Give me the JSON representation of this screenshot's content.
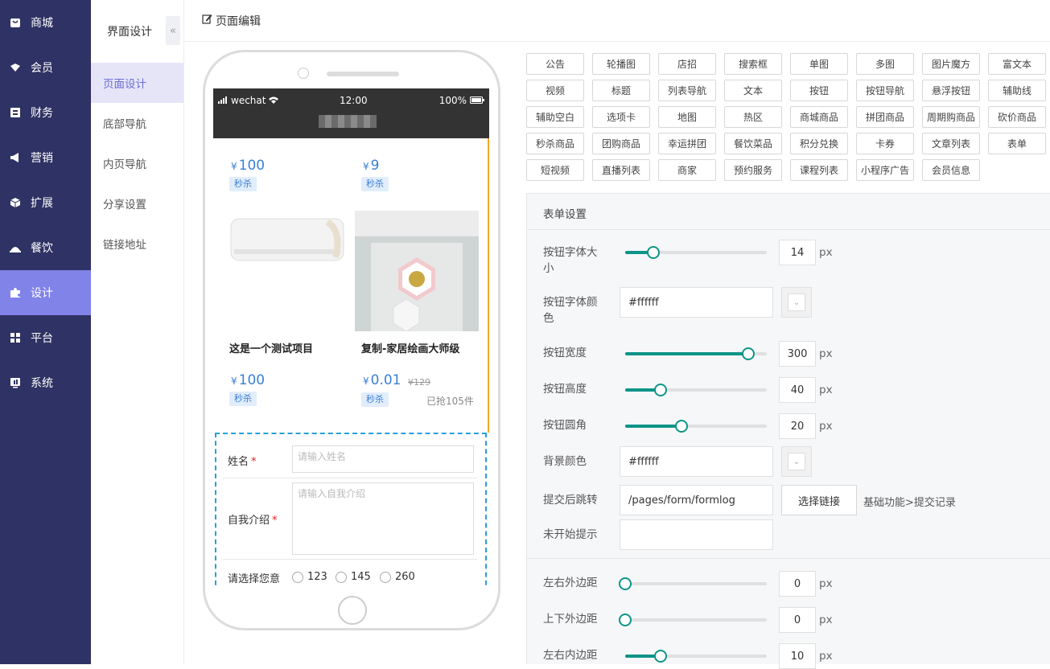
{
  "nav": {
    "items": [
      {
        "label": "商城",
        "icon": "store-icon"
      },
      {
        "label": "会员",
        "icon": "member-icon"
      },
      {
        "label": "财务",
        "icon": "finance-icon"
      },
      {
        "label": "营销",
        "icon": "megaphone-icon"
      },
      {
        "label": "扩展",
        "icon": "cube-icon"
      },
      {
        "label": "餐饮",
        "icon": "dining-icon"
      },
      {
        "label": "设计",
        "icon": "puzzle-icon"
      },
      {
        "label": "平台",
        "icon": "grid-icon"
      },
      {
        "label": "系统",
        "icon": "system-icon"
      }
    ],
    "active": "设计"
  },
  "subnav": {
    "title": "界面设计",
    "collapse": "«",
    "items": [
      "页面设计",
      "底部导航",
      "内页导航",
      "分享设置",
      "链接地址"
    ],
    "active": "页面设计"
  },
  "topbar": {
    "title": "页面编辑"
  },
  "phone": {
    "status": {
      "carrier": "wechat",
      "time": "12:00",
      "battery": "100%"
    },
    "products": [
      {
        "price": "100",
        "tag": "秒杀"
      },
      {
        "price": "9",
        "tag": "秒杀"
      },
      {
        "title": "这是一个测试项目",
        "price": "100",
        "tag": "秒杀"
      },
      {
        "title": "复制-家居绘画大师级",
        "price": "0.01",
        "old_price": "¥129",
        "tag": "秒杀",
        "sold": "已抢105件"
      }
    ],
    "currency": "¥",
    "form": {
      "name_label": "姓名",
      "name_placeholder": "请输入姓名",
      "intro_label": "自我介绍",
      "intro_placeholder": "请输入自我介绍",
      "radio_label": "请选择您意",
      "options": [
        "123",
        "145",
        "260"
      ],
      "required_mark": "*"
    }
  },
  "components": [
    [
      "公告",
      "轮播图",
      "店招",
      "搜索框",
      "单图",
      "多图",
      "图片魔方",
      "富文本"
    ],
    [
      "视频",
      "标题",
      "列表导航",
      "文本",
      "按钮",
      "按钮导航",
      "悬浮按钮",
      "辅助线"
    ],
    [
      "辅助空白",
      "选项卡",
      "地图",
      "热区",
      "商城商品",
      "拼团商品",
      "周期购商品",
      "砍价商品"
    ],
    [
      "秒杀商品",
      "团购商品",
      "幸运拼团",
      "餐饮菜品",
      "积分兑换",
      "卡券",
      "文章列表",
      "表单"
    ],
    [
      "短视频",
      "直播列表",
      "商家",
      "预约服务",
      "课程列表",
      "小程序广告",
      "会员信息"
    ]
  ],
  "settings": {
    "title": "表单设置",
    "font_size": {
      "label1": "按钮字体大",
      "label2": "小",
      "value": "14",
      "fraction": 0.2
    },
    "font_color": {
      "label1": "按钮字体颜",
      "label2": "色",
      "value": "#ffffff"
    },
    "width": {
      "label": "按钮宽度",
      "value": "300",
      "fraction": 0.87
    },
    "height": {
      "label": "按钮高度",
      "value": "40",
      "fraction": 0.25
    },
    "radius": {
      "label": "按钮圆角",
      "value": "20",
      "fraction": 0.4
    },
    "bg_color": {
      "label": "背景颜色",
      "value": "#ffffff"
    },
    "redirect": {
      "label": "提交后跳转",
      "value": "/pages/form/formlog",
      "button": "选择链接",
      "hint": "基础功能>提交记录"
    },
    "not_started": {
      "label": "未开始提示",
      "value": ""
    },
    "margin_lr": {
      "label": "左右外边距",
      "value": "0",
      "fraction": 0
    },
    "margin_tb": {
      "label": "上下外边距",
      "value": "0",
      "fraction": 0
    },
    "padding_lr": {
      "label": "左右内边距",
      "value": "10",
      "fraction": 0.25
    },
    "unit": "px"
  },
  "colors": {
    "nav_bg": "#2f3264",
    "nav_active": "#8183e8",
    "slider": "#0d9488",
    "price": "#3a7fd5"
  }
}
